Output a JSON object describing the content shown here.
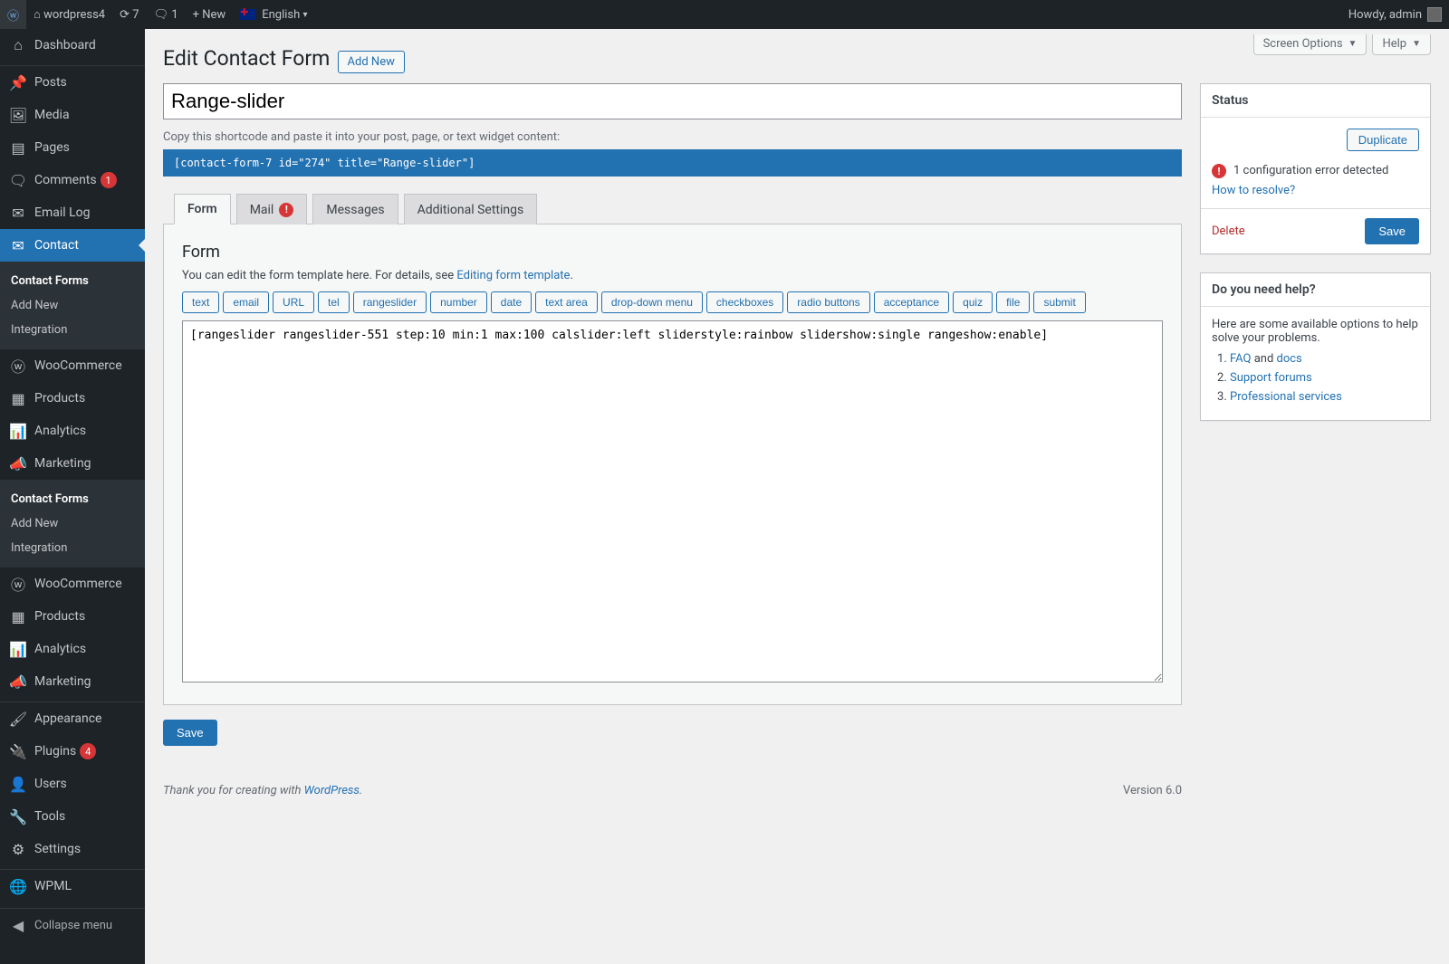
{
  "toolbar": {
    "site_name": "wordpress4",
    "updates_count": "7",
    "comments_count": "1",
    "new_label": "New",
    "language": "English",
    "howdy": "Howdy, admin"
  },
  "screen": {
    "screen_options": "Screen Options",
    "help": "Help"
  },
  "menu": {
    "dashboard": "Dashboard",
    "posts": "Posts",
    "media": "Media",
    "pages": "Pages",
    "comments": "Comments",
    "comments_badge": "1",
    "email_log": "Email Log",
    "contact": "Contact",
    "sub_contact_forms": "Contact Forms",
    "sub_add_new": "Add New",
    "sub_integration": "Integration",
    "woocommerce": "WooCommerce",
    "products": "Products",
    "analytics": "Analytics",
    "marketing": "Marketing",
    "sub2_contact_forms": "Contact Forms",
    "sub2_add_new": "Add New",
    "sub2_integration": "Integration",
    "woocommerce2": "WooCommerce",
    "products2": "Products",
    "analytics2": "Analytics",
    "marketing2": "Marketing",
    "appearance": "Appearance",
    "plugins": "Plugins",
    "plugins_badge": "4",
    "users": "Users",
    "tools": "Tools",
    "settings": "Settings",
    "wpml": "WPML",
    "collapse": "Collapse menu"
  },
  "page": {
    "title": "Edit Contact Form",
    "add_new": "Add New",
    "form_title": "Range-slider",
    "shortcode_hint": "Copy this shortcode and paste it into your post, page, or text widget content:",
    "shortcode": "[contact-form-7 id=\"274\" title=\"Range-slider\"]",
    "save": "Save"
  },
  "tabs": {
    "form": "Form",
    "mail": "Mail",
    "messages": "Messages",
    "additional": "Additional Settings"
  },
  "form_panel": {
    "heading": "Form",
    "desc_pre": "You can edit the form template here. For details, see ",
    "desc_link": "Editing form template",
    "desc_post": ".",
    "tags": [
      "text",
      "email",
      "URL",
      "tel",
      "rangeslider",
      "number",
      "date",
      "text area",
      "drop-down menu",
      "checkboxes",
      "radio buttons",
      "acceptance",
      "quiz",
      "file",
      "submit"
    ],
    "textarea": "[rangeslider rangeslider-551 step:10 min:1 max:100 calslider:left sliderstyle:rainbow slidershow:single rangeshow:enable]"
  },
  "status": {
    "heading": "Status",
    "duplicate": "Duplicate",
    "error_text": "1 configuration error detected",
    "resolve_link": "How to resolve?",
    "delete": "Delete",
    "save": "Save"
  },
  "help": {
    "heading": "Do you need help?",
    "desc": "Here are some available options to help solve your problems.",
    "faq": "FAQ",
    "and": " and ",
    "docs": "docs",
    "support": "Support forums",
    "services": "Professional services"
  },
  "footer": {
    "thanks_pre": "Thank you for creating with ",
    "wp": "WordPress",
    "thanks_post": ".",
    "version": "Version 6.0"
  }
}
